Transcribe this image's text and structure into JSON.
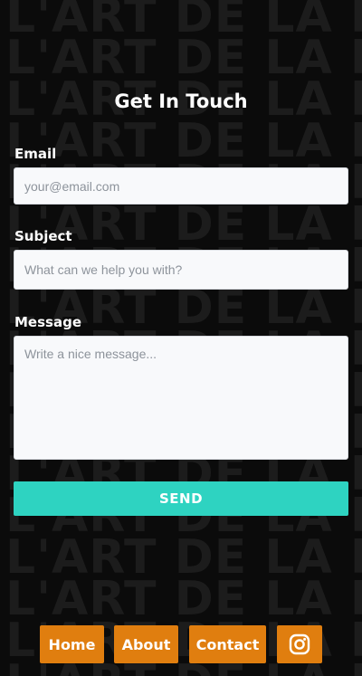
{
  "background": {
    "watermark_text": "L'ART DE LA RUE"
  },
  "form": {
    "title": "Get In Touch",
    "email": {
      "label": "Email",
      "placeholder": "your@email.com",
      "value": ""
    },
    "subject": {
      "label": "Subject",
      "placeholder": "What can we help you with?",
      "value": ""
    },
    "message": {
      "label": "Message",
      "placeholder": "Write a nice message...",
      "value": ""
    },
    "send_label": "SEND"
  },
  "nav": {
    "items": [
      {
        "label": "Home"
      },
      {
        "label": "About"
      },
      {
        "label": "Contact"
      }
    ],
    "instagram_icon": "instagram-icon"
  },
  "colors": {
    "background": "#0b0b0b",
    "watermark": "#1c1c1c",
    "send_button": "#2ed3c1",
    "nav_button": "#e07e0f"
  }
}
